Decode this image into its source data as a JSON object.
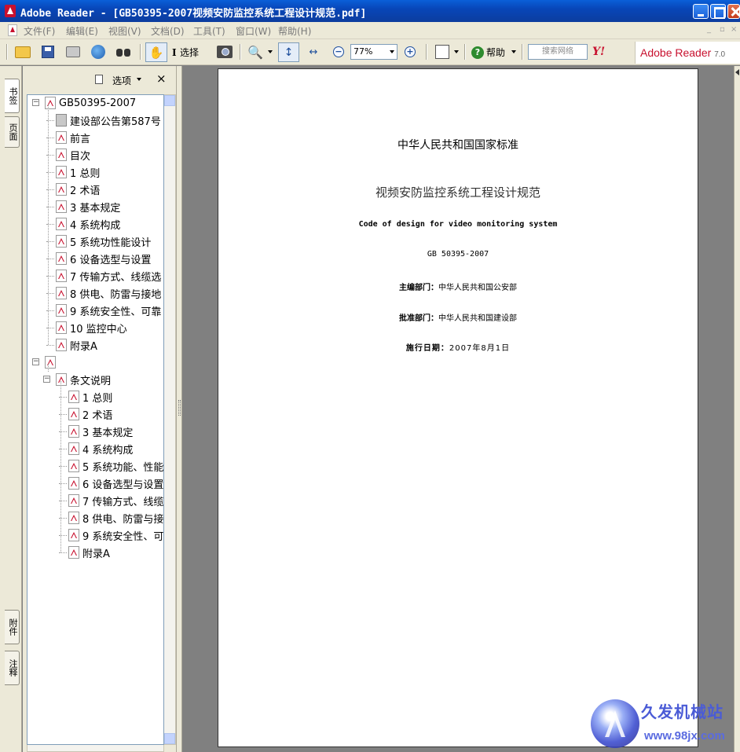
{
  "window": {
    "title": "Adobe Reader - [GB50395-2007视频安防监控系统工程设计规范.pdf]"
  },
  "menu": {
    "items": [
      "文件(F)",
      "编辑(E)",
      "视图(V)",
      "文档(D)",
      "工具(T)",
      "窗口(W)",
      "帮助(H)"
    ]
  },
  "toolbar": {
    "select_label": "选择",
    "zoom_value": "77%",
    "help_label": "帮助",
    "search_placeholder": "搜索网络",
    "yahoo_label": "Y!",
    "brand_label": "Adobe Reader",
    "brand_version": "7.0"
  },
  "side_tabs": {
    "bookmarks": "书签",
    "pages": "页面",
    "attachments": "附件",
    "comments": "注释"
  },
  "bookmarks_panel": {
    "options_label": "选项",
    "close_label": "×",
    "items": [
      {
        "label": "GB50395-2007",
        "level": 0,
        "expander": "−",
        "icon": "pdf"
      },
      {
        "label": "建设部公告第587号",
        "level": 1,
        "icon": "page"
      },
      {
        "label": "前言",
        "level": 1,
        "icon": "pdf"
      },
      {
        "label": "目次",
        "level": 1,
        "icon": "pdf"
      },
      {
        "label": "1 总则",
        "level": 1,
        "icon": "pdf"
      },
      {
        "label": "2 术语",
        "level": 1,
        "icon": "pdf"
      },
      {
        "label": "3 基本规定",
        "level": 1,
        "icon": "pdf"
      },
      {
        "label": "4 系统构成",
        "level": 1,
        "icon": "pdf"
      },
      {
        "label": "5 系统功性能设计",
        "level": 1,
        "icon": "pdf"
      },
      {
        "label": "6 设备选型与设置",
        "level": 1,
        "icon": "pdf"
      },
      {
        "label": "7 传输方式、线缆选",
        "level": 1,
        "icon": "pdf"
      },
      {
        "label": "8 供电、防雷与接地",
        "level": 1,
        "icon": "pdf"
      },
      {
        "label": "9 系统安全性、可靠",
        "level": 1,
        "icon": "pdf"
      },
      {
        "label": "10 监控中心",
        "level": 1,
        "icon": "pdf"
      },
      {
        "label": "附录A",
        "level": 1,
        "icon": "pdf"
      },
      {
        "label": "",
        "level": 0,
        "expander": "−",
        "icon": "pdf"
      },
      {
        "label": "条文说明",
        "level": 1,
        "expander": "−",
        "icon": "pdf"
      },
      {
        "label": "1 总则",
        "level": 2,
        "icon": "pdf"
      },
      {
        "label": "2 术语",
        "level": 2,
        "icon": "pdf"
      },
      {
        "label": "3 基本规定",
        "level": 2,
        "icon": "pdf"
      },
      {
        "label": "4 系统构成",
        "level": 2,
        "icon": "pdf"
      },
      {
        "label": "5 系统功能、性能",
        "level": 2,
        "icon": "pdf"
      },
      {
        "label": "6 设备选型与设置",
        "level": 2,
        "icon": "pdf"
      },
      {
        "label": "7 传输方式、线缆",
        "level": 2,
        "icon": "pdf"
      },
      {
        "label": "8 供电、防雷与接",
        "level": 2,
        "icon": "pdf"
      },
      {
        "label": "9 系统安全性、可",
        "level": 2,
        "icon": "pdf"
      },
      {
        "label": "附录A",
        "level": 2,
        "icon": "pdf"
      }
    ]
  },
  "page": {
    "line1": "中华人民共和国国家标准",
    "line2": "视频安防监控系统工程设计规范",
    "line3": "Code of design for video monitoring system",
    "line4": "GB 50395-2007",
    "editor_label": "主编部门：",
    "editor_value": "中华人民共和国公安部",
    "approver_label": "批准部门：",
    "approver_value": "中华人民共和国建设部",
    "date_label": "施行日期：",
    "date_value": "2007年8月1日"
  },
  "watermark": {
    "title": "久发机械站",
    "url": "www.98jx.com"
  }
}
